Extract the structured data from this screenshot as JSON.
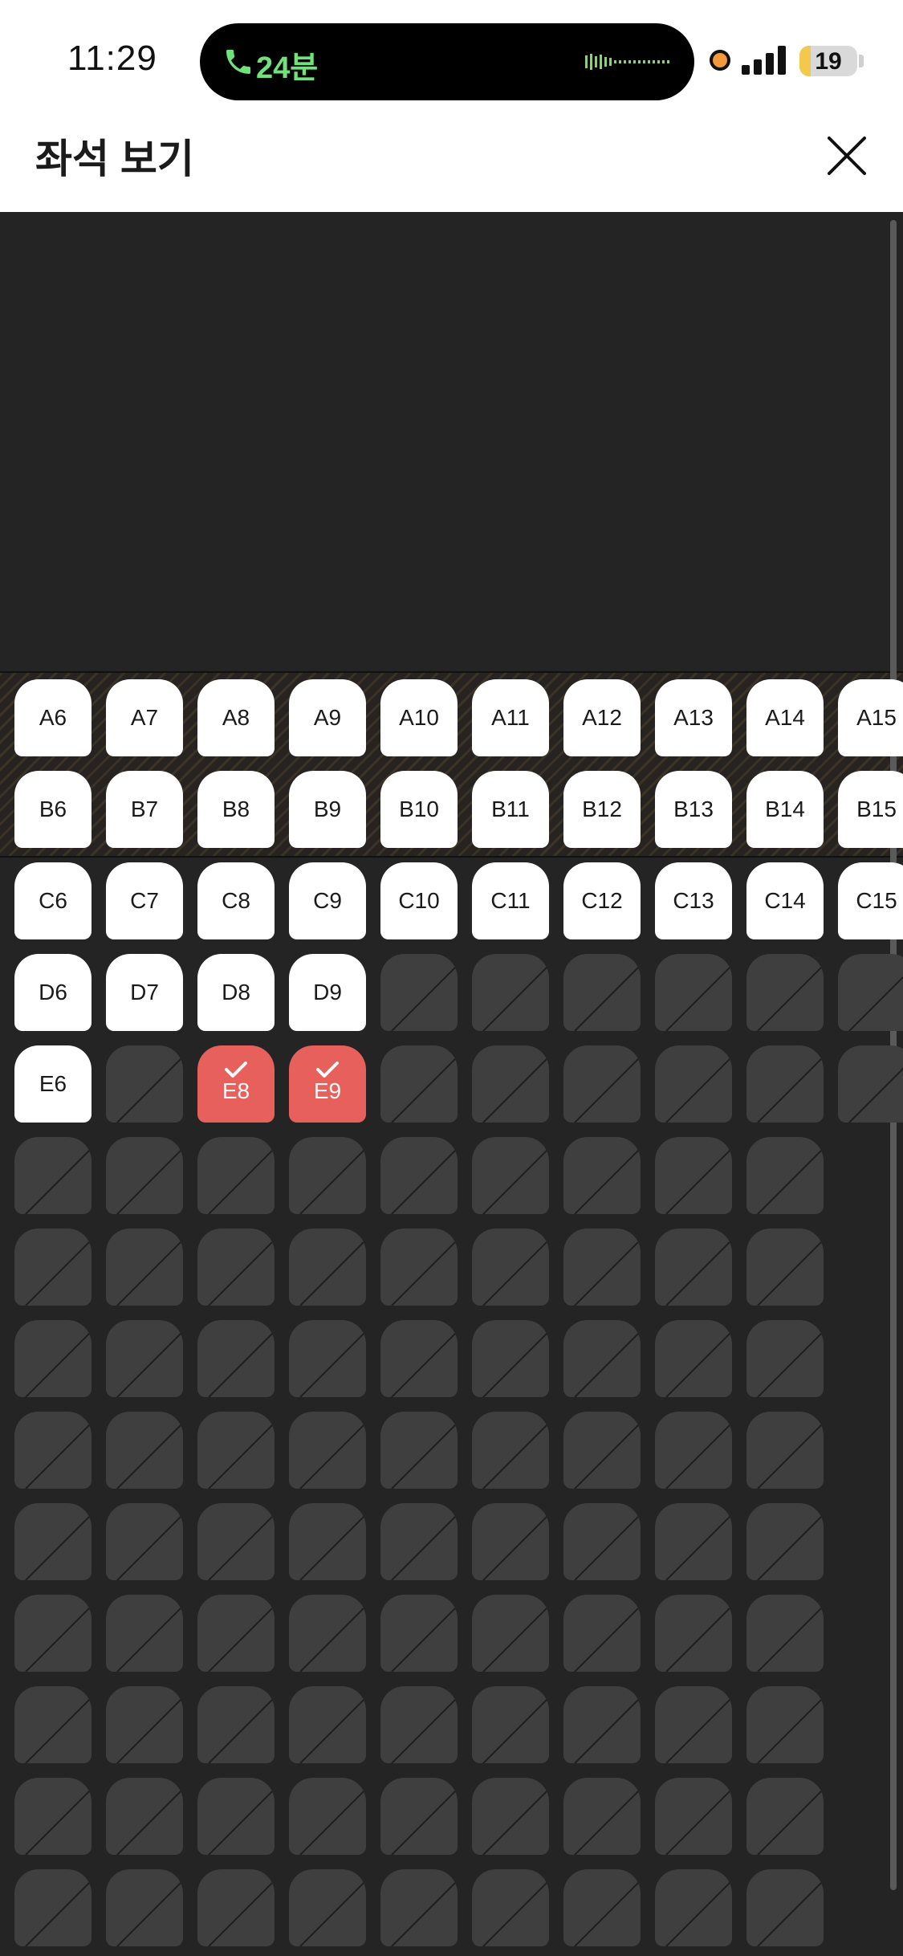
{
  "status_bar": {
    "time": "11:29",
    "call_duration": "24분",
    "battery_percent": "19",
    "battery_level": 0.19
  },
  "header": {
    "title": "좌석 보기"
  },
  "seatmap": {
    "rows": [
      {
        "row": "A",
        "seats": [
          {
            "label": "A6",
            "status": "available"
          },
          {
            "label": "A7",
            "status": "available"
          },
          {
            "label": "A8",
            "status": "available"
          },
          {
            "label": "A9",
            "status": "available"
          },
          {
            "label": "A10",
            "status": "available"
          },
          {
            "label": "A11",
            "status": "available"
          },
          {
            "label": "A12",
            "status": "available"
          },
          {
            "label": "A13",
            "status": "available"
          },
          {
            "label": "A14",
            "status": "available"
          },
          {
            "label": "A15",
            "status": "available"
          }
        ]
      },
      {
        "row": "B",
        "seats": [
          {
            "label": "B6",
            "status": "available"
          },
          {
            "label": "B7",
            "status": "available"
          },
          {
            "label": "B8",
            "status": "available"
          },
          {
            "label": "B9",
            "status": "available"
          },
          {
            "label": "B10",
            "status": "available"
          },
          {
            "label": "B11",
            "status": "available"
          },
          {
            "label": "B12",
            "status": "available"
          },
          {
            "label": "B13",
            "status": "available"
          },
          {
            "label": "B14",
            "status": "available"
          },
          {
            "label": "B15",
            "status": "available"
          }
        ]
      },
      {
        "row": "C",
        "seats": [
          {
            "label": "C6",
            "status": "available"
          },
          {
            "label": "C7",
            "status": "available"
          },
          {
            "label": "C8",
            "status": "available"
          },
          {
            "label": "C9",
            "status": "available"
          },
          {
            "label": "C10",
            "status": "available"
          },
          {
            "label": "C11",
            "status": "available"
          },
          {
            "label": "C12",
            "status": "available"
          },
          {
            "label": "C13",
            "status": "available"
          },
          {
            "label": "C14",
            "status": "available"
          },
          {
            "label": "C15",
            "status": "available"
          }
        ]
      },
      {
        "row": "D",
        "seats": [
          {
            "label": "D6",
            "status": "available"
          },
          {
            "label": "D7",
            "status": "available"
          },
          {
            "label": "D8",
            "status": "available"
          },
          {
            "label": "D9",
            "status": "available"
          },
          {
            "label": "",
            "status": "unavailable"
          },
          {
            "label": "",
            "status": "unavailable"
          },
          {
            "label": "",
            "status": "unavailable"
          },
          {
            "label": "",
            "status": "unavailable"
          },
          {
            "label": "",
            "status": "unavailable"
          },
          {
            "label": "",
            "status": "unavailable"
          }
        ]
      },
      {
        "row": "E",
        "seats": [
          {
            "label": "E6",
            "status": "available"
          },
          {
            "label": "",
            "status": "unavailable"
          },
          {
            "label": "E8",
            "status": "selected"
          },
          {
            "label": "E9",
            "status": "selected"
          },
          {
            "label": "",
            "status": "unavailable"
          },
          {
            "label": "",
            "status": "unavailable"
          },
          {
            "label": "",
            "status": "unavailable"
          },
          {
            "label": "",
            "status": "unavailable"
          },
          {
            "label": "",
            "status": "unavailable"
          },
          {
            "label": "",
            "status": "unavailable"
          }
        ]
      }
    ],
    "unavailable_grid_rows": 9,
    "unavailable_grid_cols": 9
  },
  "colors": {
    "background": "#242424",
    "seat_available": "#ffffff",
    "seat_selected": "#e8605c",
    "seat_unavailable": "#3f3f3f",
    "call_green": "#6fe37a"
  },
  "icons": [
    "phone-icon",
    "audio-wave-icon",
    "signal-icon",
    "battery-icon",
    "close-icon",
    "check-icon"
  ]
}
